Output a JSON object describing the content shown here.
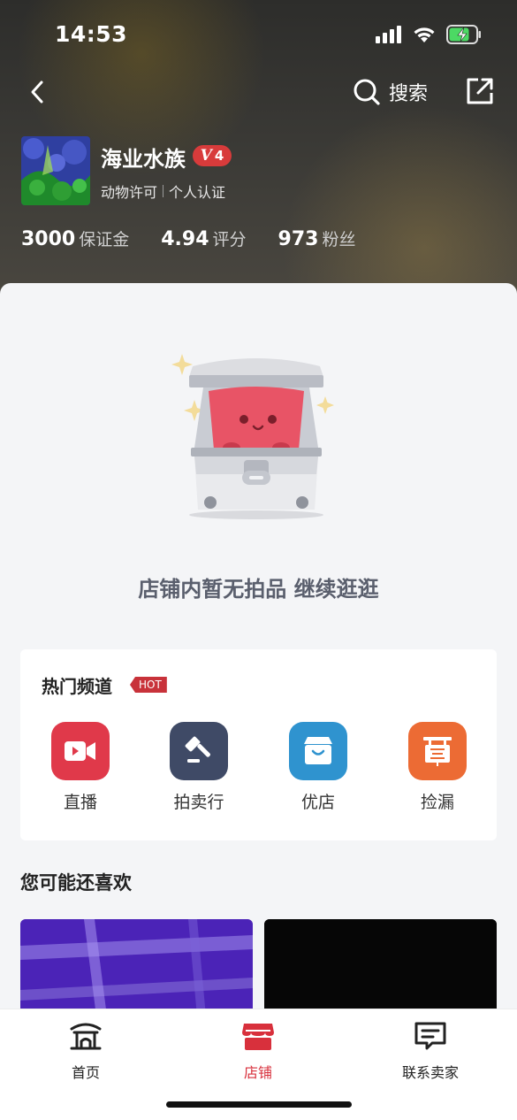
{
  "status_bar": {
    "time": "14:53"
  },
  "nav": {
    "search_label": "搜索"
  },
  "shop": {
    "name": "海业水族",
    "level_letter": "V",
    "level_number": "4",
    "tags": [
      "动物许可",
      "个人认证"
    ],
    "stats": [
      {
        "value": "3000",
        "label": "保证金"
      },
      {
        "value": "4.94",
        "label": "评分"
      },
      {
        "value": "973",
        "label": "粉丝"
      }
    ]
  },
  "empty_state": {
    "message": "店铺内暂无拍品 继续逛逛"
  },
  "channels": {
    "title": "热门频道",
    "badge": "HOT",
    "items": [
      {
        "label": "直播",
        "icon": "video-camera-icon",
        "color": "#e0394a"
      },
      {
        "label": "拍卖行",
        "icon": "gavel-icon",
        "color": "#3f4a66"
      },
      {
        "label": "优店",
        "icon": "shop-box-icon",
        "color": "#2f93cf"
      },
      {
        "label": "捡漏",
        "icon": "shop-sign-icon",
        "color": "#ec6b34"
      }
    ]
  },
  "recommend": {
    "title": "您可能还喜欢"
  },
  "tabbar": {
    "items": [
      {
        "label": "首页",
        "icon": "home-gate-icon",
        "active": false
      },
      {
        "label": "店铺",
        "icon": "store-icon",
        "active": true
      },
      {
        "label": "联系卖家",
        "icon": "message-icon",
        "active": false
      }
    ]
  },
  "colors": {
    "accent": "#d8303c",
    "level_badge": "#d83b3b",
    "hot_badge": "#c8323a"
  }
}
